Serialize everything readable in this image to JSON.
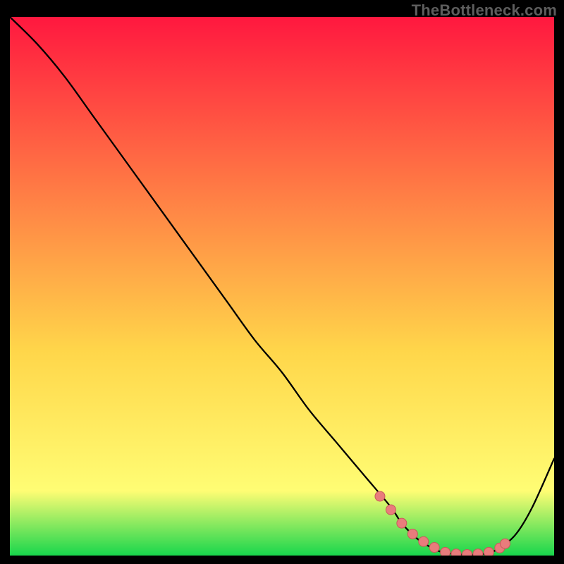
{
  "watermark": "TheBottleneck.com",
  "colors": {
    "top": "#ff183f",
    "mid1": "#ff7e45",
    "mid2": "#ffd64a",
    "mid3": "#fffd74",
    "bottom": "#18d64c",
    "curve": "#000000",
    "marker_fill": "#e97c7c",
    "marker_stroke": "#c95b5b"
  },
  "chart_data": {
    "type": "line",
    "title": "",
    "xlabel": "",
    "ylabel": "",
    "xlim": [
      0,
      100
    ],
    "ylim": [
      0,
      100
    ],
    "series": [
      {
        "name": "bottleneck-curve",
        "x": [
          0,
          5,
          10,
          15,
          20,
          25,
          30,
          35,
          40,
          45,
          50,
          55,
          60,
          65,
          70,
          72,
          75,
          78,
          80,
          83,
          86,
          88,
          90,
          93,
          96,
          100
        ],
        "values": [
          100,
          95,
          89,
          82,
          75,
          68,
          61,
          54,
          47,
          40,
          34,
          27,
          21,
          15,
          9,
          6,
          3,
          1.2,
          0.5,
          0.2,
          0.2,
          0.5,
          1.4,
          4,
          9,
          18
        ]
      }
    ],
    "markers": {
      "name": "highlight-range",
      "x": [
        68,
        70,
        72,
        74,
        76,
        78,
        80,
        82,
        84,
        86,
        88,
        90,
        91
      ],
      "values": [
        11,
        8.5,
        6.0,
        4.0,
        2.6,
        1.5,
        0.6,
        0.3,
        0.2,
        0.3,
        0.6,
        1.4,
        2.2
      ]
    }
  }
}
